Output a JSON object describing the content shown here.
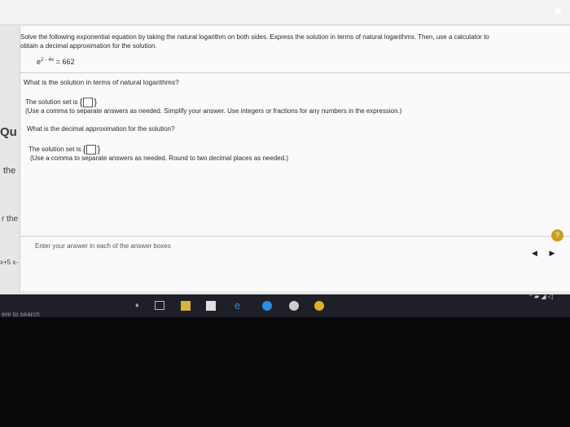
{
  "problem": {
    "instruction_line1": "Solve the following exponential equation by taking the natural logarithm on both sides. Express the solution in terms of natural logarithms. Then, use a calculator to",
    "instruction_line2": "obtain a decimal approximation for the solution.",
    "equation_base": "e",
    "equation_exponent": "2 - 4x",
    "equation_rhs": "= 662"
  },
  "part1": {
    "question": "What is the solution in terms of natural logarithms?",
    "answer_prefix": "The solution set is",
    "brace_open": "{",
    "brace_close": "}",
    "note": "(Use a comma to separate answers as needed. Simplify your answer. Use integers or fractions for any numbers in the expression.)"
  },
  "part2": {
    "question": "What is the decimal approximation for the solution?",
    "answer_prefix": "The solution set is",
    "brace_open": "{",
    "brace_close": "}",
    "note": "(Use a comma to separate answers as needed. Round to two decimal places as needed.)"
  },
  "footer": {
    "hint": "Enter your answer in each of the answer boxes",
    "help_label": "?",
    "prev_label": "◀",
    "next_label": "▶"
  },
  "left_edge": {
    "text1": "Qu",
    "text2": "the",
    "text3": "r the",
    "text4": "x+5 x-"
  },
  "taskbar": {
    "search_placeholder": "ere to search",
    "tray_text": "^ ▰ ◢ ◁"
  },
  "colors": {
    "taskbar_bg": "#1f1f27",
    "help_badge": "#c9a01f",
    "page_bg": "#fafafa"
  }
}
